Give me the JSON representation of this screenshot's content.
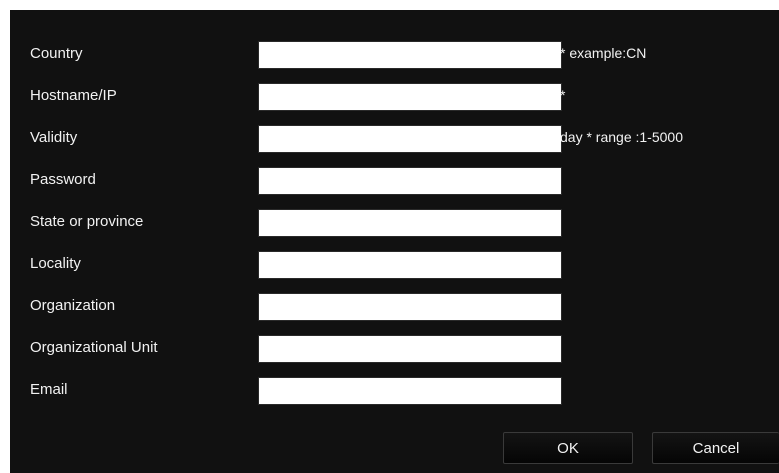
{
  "form": {
    "fields": [
      {
        "label": "Country",
        "value": "",
        "hint": "* example:CN"
      },
      {
        "label": "Hostname/IP",
        "value": "",
        "hint": "*"
      },
      {
        "label": "Validity",
        "value": "",
        "hint": "day *  range :1-5000"
      },
      {
        "label": "Password",
        "value": "",
        "hint": ""
      },
      {
        "label": "State or province",
        "value": "",
        "hint": ""
      },
      {
        "label": "Locality",
        "value": "",
        "hint": ""
      },
      {
        "label": "Organization",
        "value": "",
        "hint": ""
      },
      {
        "label": "Organizational Unit",
        "value": "",
        "hint": ""
      },
      {
        "label": "Email",
        "value": "",
        "hint": ""
      }
    ]
  },
  "buttons": {
    "ok_label": "OK",
    "cancel_label": "Cancel"
  },
  "colors": {
    "background": "#111111",
    "text": "#f2f2f2",
    "input_background": "#ffffff"
  }
}
